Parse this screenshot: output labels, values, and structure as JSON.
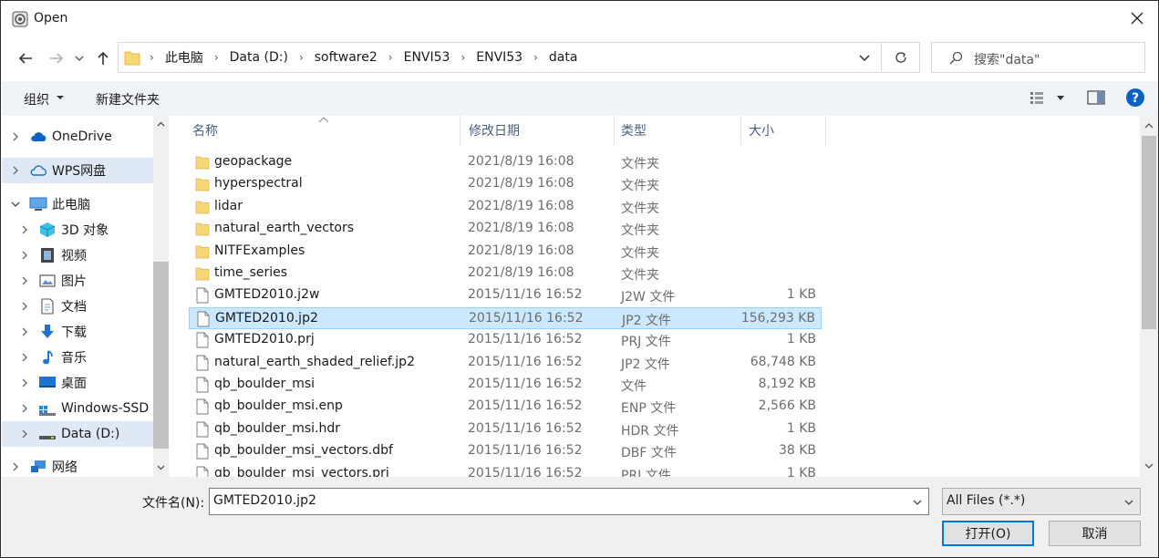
{
  "window": {
    "title": "Open"
  },
  "address": {
    "crumbs": [
      "此电脑",
      "Data (D:)",
      "software2",
      "ENVI53",
      "ENVI53",
      "data"
    ]
  },
  "search": {
    "placeholder": "搜索\"data\""
  },
  "toolbar": {
    "organize_label": "组织",
    "new_folder_label": "新建文件夹"
  },
  "nav": {
    "items": [
      {
        "label": "OneDrive",
        "icon": "cloud-icon",
        "level": 0,
        "expanded": false,
        "selected": false
      },
      {
        "label": "WPS网盘",
        "icon": "cloud-outline-icon",
        "level": 0,
        "expanded": false,
        "selected": true
      },
      {
        "label": "此电脑",
        "icon": "computer-icon",
        "level": 0,
        "expanded": true,
        "selected": false
      },
      {
        "label": "3D 对象",
        "icon": "cube-icon",
        "level": 1,
        "expanded": false,
        "selected": false
      },
      {
        "label": "视频",
        "icon": "film-icon",
        "level": 1,
        "expanded": false,
        "selected": false
      },
      {
        "label": "图片",
        "icon": "picture-icon",
        "level": 1,
        "expanded": false,
        "selected": false
      },
      {
        "label": "文档",
        "icon": "document-icon",
        "level": 1,
        "expanded": false,
        "selected": false
      },
      {
        "label": "下载",
        "icon": "download-arrow-icon",
        "level": 1,
        "expanded": false,
        "selected": false
      },
      {
        "label": "音乐",
        "icon": "music-note-icon",
        "level": 1,
        "expanded": false,
        "selected": false
      },
      {
        "label": "桌面",
        "icon": "desktop-icon",
        "level": 1,
        "expanded": false,
        "selected": false
      },
      {
        "label": "Windows-SSD",
        "icon": "drive-windows-icon",
        "level": 1,
        "expanded": false,
        "selected": false
      },
      {
        "label": "Data (D:)",
        "icon": "drive-icon",
        "level": 1,
        "expanded": false,
        "selected": true
      },
      {
        "label": "网络",
        "icon": "network-icon",
        "level": 0,
        "expanded": false,
        "selected": false
      }
    ]
  },
  "columns": {
    "name": "名称",
    "date": "修改日期",
    "type": "类型",
    "size": "大小"
  },
  "files": [
    {
      "name": "geopackage",
      "date": "2021/8/19 16:08",
      "type": "文件夹",
      "size": "",
      "kind": "folder"
    },
    {
      "name": "hyperspectral",
      "date": "2021/8/19 16:08",
      "type": "文件夹",
      "size": "",
      "kind": "folder"
    },
    {
      "name": "lidar",
      "date": "2021/8/19 16:08",
      "type": "文件夹",
      "size": "",
      "kind": "folder"
    },
    {
      "name": "natural_earth_vectors",
      "date": "2021/8/19 16:08",
      "type": "文件夹",
      "size": "",
      "kind": "folder"
    },
    {
      "name": "NITFExamples",
      "date": "2021/8/19 16:08",
      "type": "文件夹",
      "size": "",
      "kind": "folder"
    },
    {
      "name": "time_series",
      "date": "2021/8/19 16:08",
      "type": "文件夹",
      "size": "",
      "kind": "folder"
    },
    {
      "name": "GMTED2010.j2w",
      "date": "2015/11/16 16:52",
      "type": "J2W 文件",
      "size": "1 KB",
      "kind": "file"
    },
    {
      "name": "GMTED2010.jp2",
      "date": "2015/11/16 16:52",
      "type": "JP2 文件",
      "size": "156,293 KB",
      "kind": "file",
      "selected": true
    },
    {
      "name": "GMTED2010.prj",
      "date": "2015/11/16 16:52",
      "type": "PRJ 文件",
      "size": "1 KB",
      "kind": "file"
    },
    {
      "name": "natural_earth_shaded_relief.jp2",
      "date": "2015/11/16 16:52",
      "type": "JP2 文件",
      "size": "68,748 KB",
      "kind": "file"
    },
    {
      "name": "qb_boulder_msi",
      "date": "2015/11/16 16:52",
      "type": "文件",
      "size": "8,192 KB",
      "kind": "file"
    },
    {
      "name": "qb_boulder_msi.enp",
      "date": "2015/11/16 16:52",
      "type": "ENP 文件",
      "size": "2,566 KB",
      "kind": "file"
    },
    {
      "name": "qb_boulder_msi.hdr",
      "date": "2015/11/16 16:52",
      "type": "HDR 文件",
      "size": "1 KB",
      "kind": "file"
    },
    {
      "name": "qb_boulder_msi_vectors.dbf",
      "date": "2015/11/16 16:52",
      "type": "DBF 文件",
      "size": "38 KB",
      "kind": "file"
    },
    {
      "name": "qb_boulder_msi_vectors.prj",
      "date": "2015/11/16 16:52",
      "type": "PRJ 文件",
      "size": "1 KB",
      "kind": "file"
    }
  ],
  "filename": {
    "label": "文件名(N):",
    "value": "GMTED2010.jp2"
  },
  "filetype": {
    "value": "All Files (*.*)"
  },
  "buttons": {
    "open": "打开(O)",
    "cancel": "取消"
  },
  "colors": {
    "accent": "#0078d7",
    "folder": "#f8d775",
    "selection": "#cce8ff",
    "toolbar_bg": "#f0f4f9"
  }
}
